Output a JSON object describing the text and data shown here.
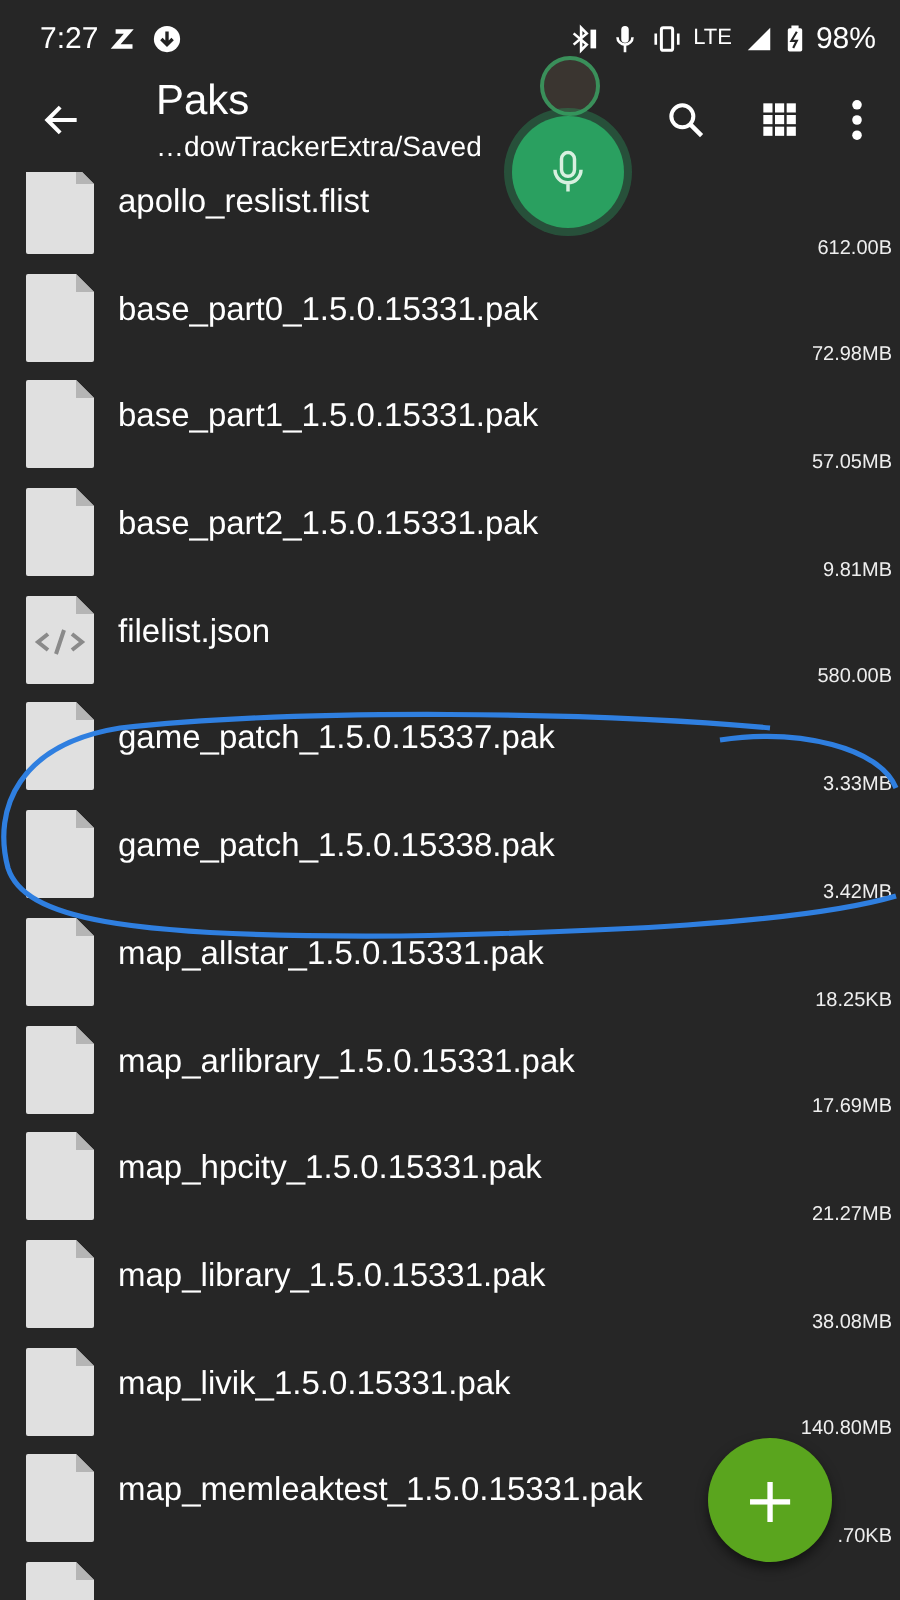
{
  "status_bar": {
    "time": "7:27",
    "battery": "98%",
    "network": "LTE"
  },
  "toolbar": {
    "title": "Paks",
    "subtitle": "…dowTrackerExtra/Saved"
  },
  "files": [
    {
      "name": "apollo_reslist.flist",
      "size": "612.00B",
      "kind": "file"
    },
    {
      "name": "base_part0_1.5.0.15331.pak",
      "size": "72.98MB",
      "kind": "file"
    },
    {
      "name": "base_part1_1.5.0.15331.pak",
      "size": "57.05MB",
      "kind": "file"
    },
    {
      "name": "base_part2_1.5.0.15331.pak",
      "size": "9.81MB",
      "kind": "file"
    },
    {
      "name": "filelist.json",
      "size": "580.00B",
      "kind": "code"
    },
    {
      "name": "game_patch_1.5.0.15337.pak",
      "size": "3.33MB",
      "kind": "file"
    },
    {
      "name": "game_patch_1.5.0.15338.pak",
      "size": "3.42MB",
      "kind": "file"
    },
    {
      "name": "map_allstar_1.5.0.15331.pak",
      "size": "18.25KB",
      "kind": "file"
    },
    {
      "name": "map_arlibrary_1.5.0.15331.pak",
      "size": "17.69MB",
      "kind": "file"
    },
    {
      "name": "map_hpcity_1.5.0.15331.pak",
      "size": "21.27MB",
      "kind": "file"
    },
    {
      "name": "map_library_1.5.0.15331.pak",
      "size": "38.08MB",
      "kind": "file"
    },
    {
      "name": "map_livik_1.5.0.15331.pak",
      "size": "140.80MB",
      "kind": "file"
    },
    {
      "name": "map_memleaktest_1.5.0.15331.pak",
      "size": ".70KB",
      "kind": "file"
    },
    {
      "kind": "file"
    }
  ],
  "fab": {
    "label": "+"
  }
}
